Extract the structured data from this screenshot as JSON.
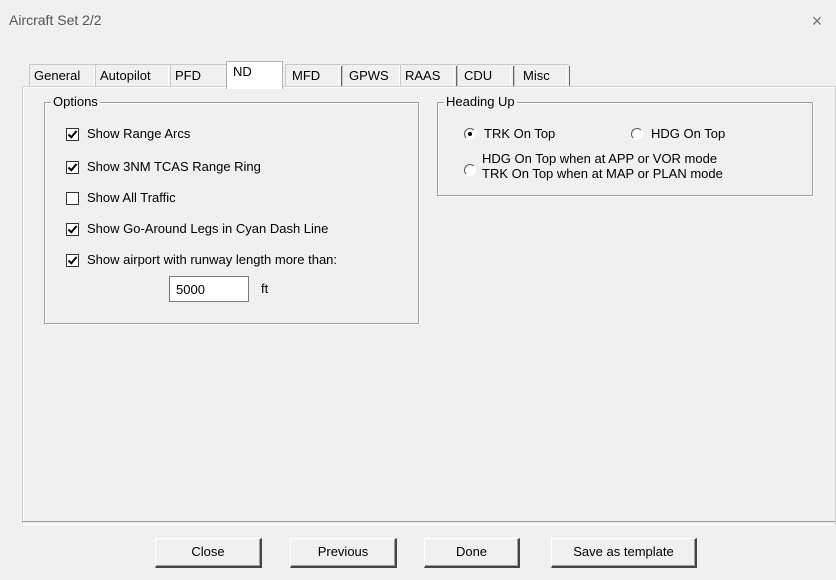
{
  "window": {
    "title": "Aircraft Set 2/2",
    "close_symbol": "×"
  },
  "tabs": [
    {
      "label": "General",
      "active": false
    },
    {
      "label": "Autopilot",
      "active": false
    },
    {
      "label": "PFD",
      "active": false
    },
    {
      "label": "ND",
      "active": true
    },
    {
      "label": "MFD",
      "active": false
    },
    {
      "label": "GPWS",
      "active": false
    },
    {
      "label": "RAAS",
      "active": false
    },
    {
      "label": "CDU",
      "active": false
    },
    {
      "label": "Misc",
      "active": false
    }
  ],
  "options": {
    "label": "Options",
    "items": [
      {
        "label": "Show Range Arcs",
        "checked": true
      },
      {
        "label": "Show 3NM TCAS Range Ring",
        "checked": true
      },
      {
        "label": "Show All Traffic",
        "checked": false
      },
      {
        "label": "Show Go-Around Legs in Cyan Dash Line",
        "checked": true
      },
      {
        "label": "Show airport with runway length more than:",
        "checked": true
      }
    ],
    "runway_length_value": "5000",
    "runway_length_unit": "ft"
  },
  "heading_up": {
    "label": "Heading Up",
    "trk_on_top": {
      "label": "TRK On Top",
      "selected": true
    },
    "hdg_on_top": {
      "label": "HDG On Top",
      "selected": false
    },
    "mixed": {
      "line1": "HDG On Top when at APP or VOR mode",
      "line2": "TRK On Top when at MAP or PLAN mode",
      "selected": false
    }
  },
  "buttons": {
    "close": "Close",
    "previous": "Previous",
    "done": "Done",
    "save_template": "Save as template"
  }
}
